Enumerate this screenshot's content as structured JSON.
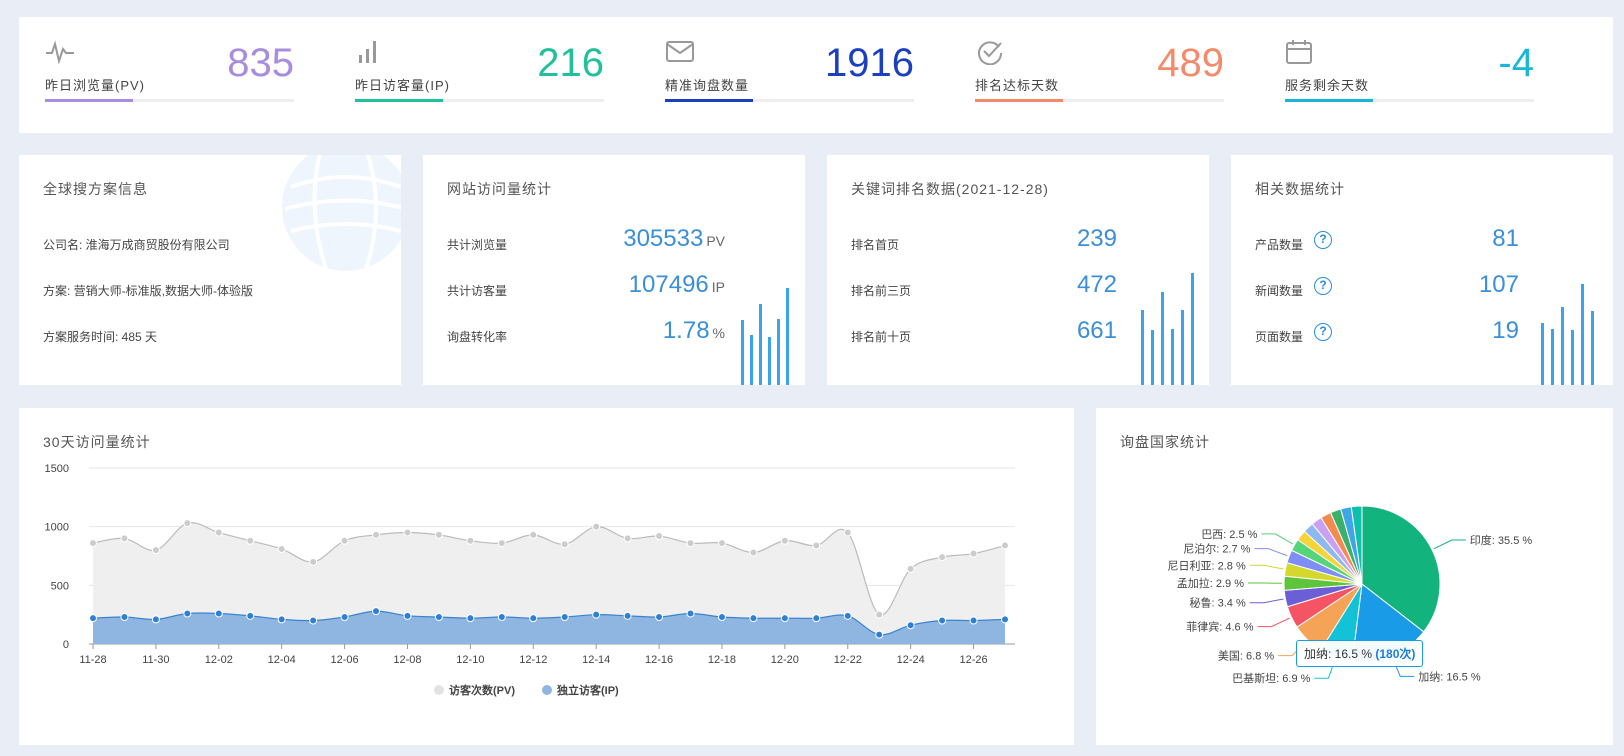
{
  "stats": [
    {
      "label": "昨日浏览量(PV)",
      "value": "835",
      "color": "#a78ce0",
      "icon": "activity-icon"
    },
    {
      "label": "昨日访客量(IP)",
      "value": "216",
      "color": "#20c09a",
      "icon": "bar-chart-icon"
    },
    {
      "label": "精准询盘数量",
      "value": "1916",
      "color": "#1a3fbf",
      "icon": "mail-icon"
    },
    {
      "label": "排名达标天数",
      "value": "489",
      "color": "#f48a6a",
      "icon": "check-circle-icon"
    },
    {
      "label": "服务剩余天数",
      "value": "-4",
      "color": "#1ab6d8",
      "icon": "calendar-icon"
    }
  ],
  "plan": {
    "title": "全球搜方案信息",
    "company": "公司名: 淮海万成商贸股份有限公司",
    "scheme": "方案: 营销大师-标准版,数据大师-体验版",
    "duration": "方案服务时间: 485 天"
  },
  "visits": {
    "title": "网站访问量统计",
    "rows": [
      {
        "label": "共计浏览量",
        "value": "305533",
        "unit": "PV"
      },
      {
        "label": "共计访客量",
        "value": "107496",
        "unit": "IP"
      },
      {
        "label": "询盘转化率",
        "value": "1.78",
        "unit": "%"
      }
    ]
  },
  "keywords": {
    "title": "关键词排名数据(2021-12-28)",
    "rows": [
      {
        "label": "排名首页",
        "value": "239"
      },
      {
        "label": "排名前三页",
        "value": "472"
      },
      {
        "label": "排名前十页",
        "value": "661"
      }
    ]
  },
  "related": {
    "title": "相关数据统计",
    "rows": [
      {
        "label": "产品数量",
        "value": "81"
      },
      {
        "label": "新闻数量",
        "value": "107"
      },
      {
        "label": "页面数量",
        "value": "19"
      }
    ],
    "help_glyph": "?"
  },
  "trend": {
    "title": "30天访问量统计",
    "legend_pv": "访客次数(PV)",
    "legend_ip": "独立访客(IP)"
  },
  "country": {
    "title": "询盘国家统计",
    "tooltip_name": "加纳: 16.5 %",
    "tooltip_count": "(180次)"
  },
  "chart_data": [
    {
      "type": "area",
      "title": "30天访问量统计",
      "x": [
        "11-28",
        "11-29",
        "11-30",
        "12-01",
        "12-02",
        "12-03",
        "12-04",
        "12-05",
        "12-06",
        "12-07",
        "12-08",
        "12-09",
        "12-10",
        "12-11",
        "12-12",
        "12-13",
        "12-14",
        "12-15",
        "12-16",
        "12-17",
        "12-18",
        "12-19",
        "12-20",
        "12-21",
        "12-22",
        "12-23",
        "12-24",
        "12-25",
        "12-26",
        "12-27"
      ],
      "x_tick_labels": [
        "11-28",
        "11-30",
        "12-02",
        "12-04",
        "12-06",
        "12-08",
        "12-10",
        "12-12",
        "12-14",
        "12-16",
        "12-18",
        "12-20",
        "12-22",
        "12-24",
        "12-26"
      ],
      "y_ticks": [
        0,
        500,
        1000,
        1500
      ],
      "ylim": [
        0,
        1500
      ],
      "series": [
        {
          "name": "访客次数(PV)",
          "color": "#c8c8c8",
          "values": [
            860,
            900,
            800,
            1030,
            950,
            880,
            810,
            700,
            880,
            930,
            950,
            930,
            880,
            860,
            930,
            850,
            1000,
            900,
            920,
            860,
            860,
            780,
            880,
            840,
            950,
            250,
            640,
            740,
            770,
            840
          ]
        },
        {
          "name": "独立访客(IP)",
          "color": "#3a83d0",
          "values": [
            220,
            230,
            210,
            260,
            260,
            240,
            210,
            200,
            230,
            280,
            240,
            230,
            220,
            230,
            220,
            230,
            250,
            240,
            230,
            260,
            230,
            220,
            220,
            220,
            240,
            80,
            160,
            200,
            200,
            210
          ]
        }
      ],
      "legend": "bottom",
      "grid": true
    },
    {
      "type": "pie",
      "title": "询盘国家统计",
      "labels": [
        "印度",
        "加纳",
        "巴基斯坦",
        "美国",
        "菲律宾",
        "秘鲁",
        "孟加拉",
        "尼日利亚",
        "尼泊尔",
        "巴西"
      ],
      "values": [
        35.5,
        16.5,
        6.9,
        6.8,
        4.6,
        3.4,
        2.9,
        2.8,
        2.7,
        2.5
      ],
      "label_text": [
        "印度: 35.5 %",
        "加纳: 16.5 %",
        "巴基斯坦: 6.9 %",
        "美国: 6.8 %",
        "菲律宾: 4.6 %",
        "秘鲁: 3.4 %",
        "孟加拉: 2.9 %",
        "尼日利亚: 2.8 %",
        "尼泊尔: 2.7 %",
        "巴西: 2.5 %"
      ],
      "colors": [
        "#12b37d",
        "#1a9be8",
        "#13c2d6",
        "#f5a356",
        "#f55464",
        "#6a5fd6",
        "#5ec43a",
        "#d4d72c",
        "#7d8ff5",
        "#55d47a"
      ],
      "other_colors": [
        "#f5d43a",
        "#90b8f0",
        "#c9a0f2",
        "#f38b4e",
        "#3ab06a",
        "#3ea5e6",
        "#0fbfae"
      ]
    }
  ]
}
